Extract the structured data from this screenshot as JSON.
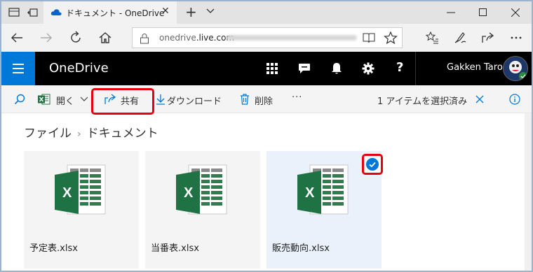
{
  "browser": {
    "tab_title": "ドキュメント - OneDrive",
    "url_host": "onedrive",
    "url_domain": ".live.com",
    "new_tab": "+",
    "close_tab": "✕"
  },
  "header": {
    "app_name": "OneDrive",
    "user_name": "Gakken Taro",
    "help": "?"
  },
  "commands": {
    "open": "開く",
    "share": "共有",
    "download": "ダウンロード",
    "delete": "削除",
    "more": "···",
    "selection_status": "1 アイテムを選択済み"
  },
  "breadcrumb": {
    "root": "ファイル",
    "sep": "›",
    "current": "ドキュメント"
  },
  "files": [
    {
      "name": "予定表.xlsx",
      "selected": false
    },
    {
      "name": "当番表.xlsx",
      "selected": false
    },
    {
      "name": "販売動向.xlsx",
      "selected": true
    }
  ],
  "colors": {
    "accent": "#0078d7",
    "excel_green": "#1f7244",
    "highlight_red": "#e50012"
  },
  "icons": {
    "excel": "X"
  }
}
